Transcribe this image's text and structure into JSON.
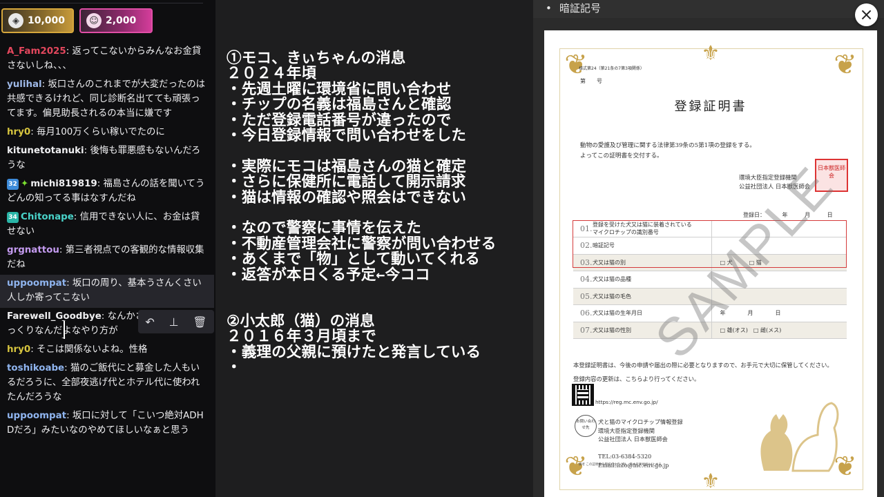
{
  "chat": {
    "points": [
      {
        "amount": "10,000",
        "icon": "channel-points-gold-icon"
      },
      {
        "amount": "2,000",
        "icon": "channel-points-pink-icon"
      }
    ],
    "messages": [
      {
        "user": "A_Fam2025",
        "color": "#e3475d",
        "text": "返ってこないからみんなお金貸さないしね、、、"
      },
      {
        "user": "yulihal",
        "color": "#9fb9e8",
        "text": "坂口さんのこれまでが大変だったのは共感できるけれど、同じ診断名出てても頑張ってます。偏見助長されるの本当に嫌です"
      },
      {
        "user": "hry0",
        "color": "#d7c53f",
        "text": "毎月100万くらい稼いでたのに"
      },
      {
        "user": "kitunetotanuki",
        "color": "#efeff1",
        "text": "後悔も罪悪感もないんだろうな"
      },
      {
        "user": "michi819819",
        "color": "#efeff1",
        "text": "福島さんの話を聞いてうどんの知ってる事はなすんだね",
        "sub": "32",
        "star": true
      },
      {
        "user": "Chitonape",
        "color": "#49d3c9",
        "text": "信用できない人に、お金は貸せない",
        "sub": "34"
      },
      {
        "user": "grgnattou",
        "color": "#c49bf0",
        "text": "第三者視点での客観的な情報収集だね"
      },
      {
        "user": "uppoompat",
        "color": "#8fb4ee",
        "text": "坂口の周り、基本うさんくさい人しか寄ってこない",
        "highlight": true
      },
      {
        "user": "Farewell_Goodbye",
        "color": "#efeff1",
        "text": "なんかさくら咲くにそっくりなんだよなやり方が"
      },
      {
        "user": "hry0",
        "color": "#d7c53f",
        "text": "そこは関係ないよね。性格"
      },
      {
        "user": "toshikoabe",
        "color": "#8fb4ee",
        "text": "猫のご飯代にと募金した人もいるだろうに、全部夜逃げ代とホテル代に使われたんだろうな"
      },
      {
        "user": "uppoompat",
        "color": "#8fb4ee",
        "text": "坂口に対して「こいつ絶対ADHDだろ」みたいなのやめてほしいなぁと思う"
      }
    ],
    "tools": [
      "reply-icon",
      "pin-icon",
      "delete-icon"
    ]
  },
  "notes": {
    "text": "①モコ、きぃちゃんの消息\n２０２４年頃\n・先週土曜に環境省に問い合わせ\n・チップの名義は福島さんと確認\n・ただ登録電話番号が違ったので\n・今日登録情報で問い合わせをした\n\n・実際にモコは福島さんの猫と確定\n・さらに保健所に電話して開示請求\n・猫は情報の確認や照会はできない\n\n・なので警察に事情を伝えた\n・不動産管理会社に警察が問い合わせる\n・あくまで「物」として動いてくれる\n・返答が本日くる予定←今ココ\n\n\n②小太郎（猫）の消息\n２０１６年３月頃まで\n・義理の父親に預けたと発言している\n・"
  },
  "viewer": {
    "header_bullet": "•",
    "header_title": "暗証記号",
    "close_label": "×",
    "certificate": {
      "form_no": "様式第24（第21条の7第3項関係）",
      "number_label": "第　　号",
      "title": "登録証明書",
      "body": "動物の愛護及び管理に関する法律第39条の5第1項の登録をする。\nよってこの証明書を交付する。",
      "issuer": "環境大臣指定登録機関\n公益社団法人 日本獣医師会",
      "seal_text": "日本獣医師会",
      "date_label": "登録日： 年 月 日",
      "rows": [
        {
          "no": "01.",
          "label": "登録を受けた犬又は猫に装着されている\nマイクロチップの識別番号",
          "value": ""
        },
        {
          "no": "02.",
          "label": "暗証記号",
          "value": ""
        },
        {
          "no": "03.",
          "label": "犬又は猫の別",
          "value": "□ 犬　　　□ 猫"
        },
        {
          "no": "04.",
          "label": "犬又は猫の品種",
          "value": ""
        },
        {
          "no": "05.",
          "label": "犬又は猫の毛色",
          "value": ""
        },
        {
          "no": "06.",
          "label": "犬又は猫の生年月日",
          "value": "年　　　　月　　　　日"
        },
        {
          "no": "07.",
          "label": "犬又は猫の性別",
          "value": "□ 雄(オス)　□ 雌(メス)"
        }
      ],
      "note": "本登録証明書は、今後の申請や届出の際に必要となりますので、お手元で大切に保管してください。\n登録内容の更新は、こちらより行ってください。",
      "url": "https://reg.mc.env.go.jp/",
      "contact_circle": "お問い合わせ先",
      "contact": "犬と猫のマイクロチップ情報登録\n環境大臣指定登録機関\n公益社団法人 日本獣医師会\n\nTEL:03-6384-5320\nEmail:info@mc.env.go.jp",
      "footnote": "備考 この証明書の用紙の大きさは、日本産業規格A4とする。",
      "watermark": "SAMPLE"
    }
  }
}
